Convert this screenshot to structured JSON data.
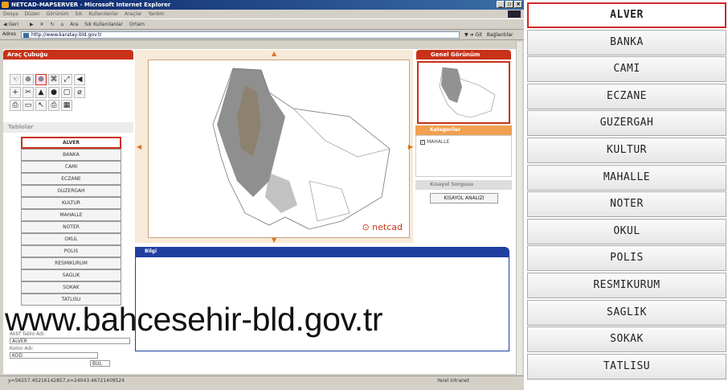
{
  "window": {
    "title": "NETCAD-MAPSERVER - Microsoft Internet Explorer",
    "min": "_",
    "max": "▫",
    "close": "×"
  },
  "menu": {
    "items": "Dosya Düzen Görünüm Sık Kullanılanlar Araçlar Yardım"
  },
  "toolbar": {
    "back": "Geri",
    "search": "Ara",
    "favorites": "Sık Kullanılanlar",
    "media": "Ortam"
  },
  "address": {
    "label": "Adres",
    "url": "http://www.karatay-bld.gov.tr",
    "go": "Git",
    "links": "Bağlantılar"
  },
  "sidebar": {
    "title": "Araç Çubuğu",
    "tables_title": "Tablolar"
  },
  "tables": [
    "ALVER",
    "BANKA",
    "CAMI",
    "ECZANE",
    "GUZERGAH",
    "KULTUR",
    "MAHALLE",
    "NOTER",
    "OKUL",
    "POLIS",
    "RESMIKURUM",
    "SAGLIK",
    "SOKAK",
    "TATLISU"
  ],
  "form": {
    "active_table_label": "Aktif Tablo Adı:",
    "active_table_value": "ALVER",
    "column_label": "Kolon Adı:",
    "column_value": "KOD",
    "search_btn": "BUL"
  },
  "map": {
    "brand": "netcad"
  },
  "overview": {
    "title": "Genel Görünüm"
  },
  "categories": {
    "title": "Kategoriler",
    "item": "MAHALLE"
  },
  "shortcut": {
    "title": "Kısayol Sorgusu",
    "button": "KISAYOL ANALIZI"
  },
  "info": {
    "title": "Bilgi"
  },
  "status": {
    "coords": "y=56557.45216142857,x=24043.46721409524",
    "zone": "Yerel intranet"
  },
  "watermark": "www.bahcesehir-bld.gov.tr",
  "side_list": [
    "ALVER",
    "BANKA",
    "CAMI",
    "ECZANE",
    "GUZERGAH",
    "KULTUR",
    "MAHALLE",
    "NOTER",
    "OKUL",
    "POLIS",
    "RESMIKURUM",
    "SAGLIK",
    "SOKAK",
    "TATLISU"
  ]
}
